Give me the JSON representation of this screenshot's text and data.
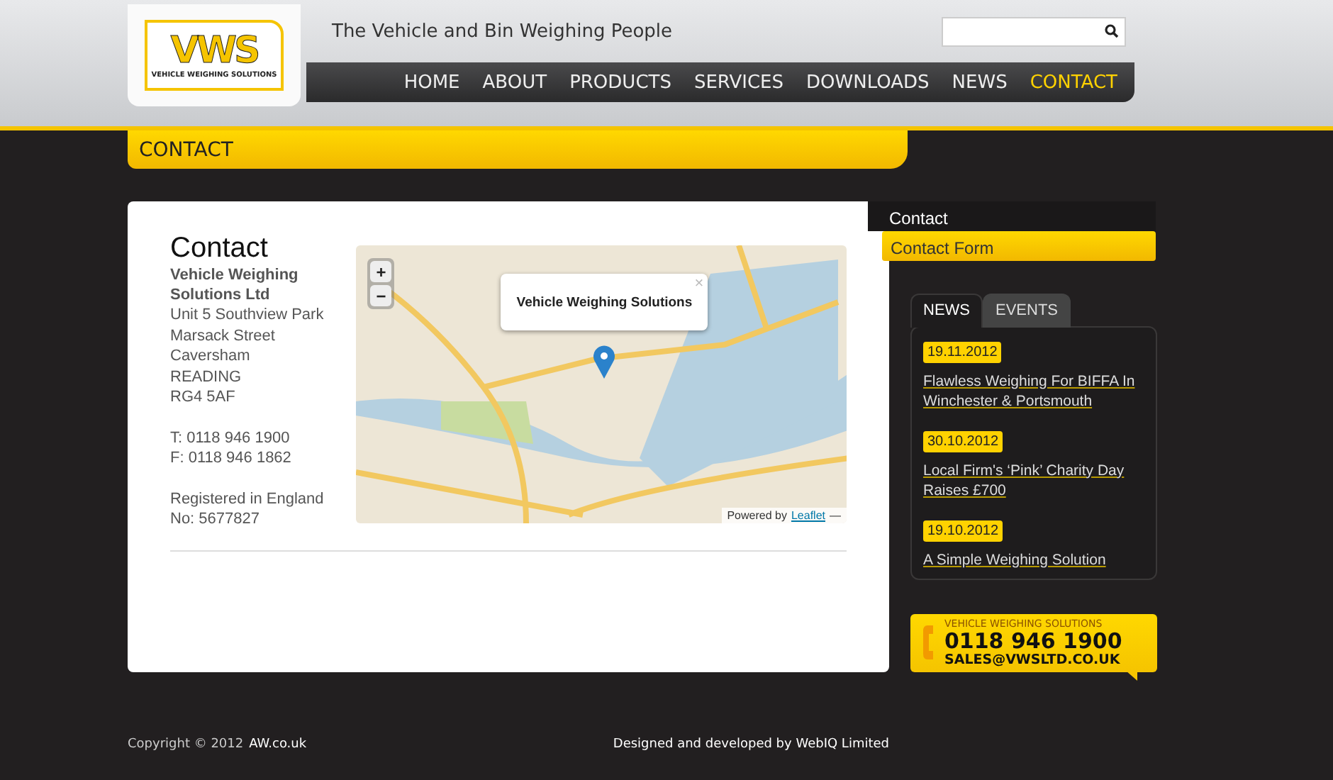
{
  "header": {
    "logo": {
      "mark": "VWS",
      "subtitle": "VEHICLE WEIGHING SOLUTIONS"
    },
    "tagline": "The Vehicle and Bin Weighing People",
    "nav": [
      {
        "label": "HOME",
        "selected": false
      },
      {
        "label": "ABOUT",
        "selected": false
      },
      {
        "label": "PRODUCTS",
        "selected": false
      },
      {
        "label": "SERVICES",
        "selected": false
      },
      {
        "label": "DOWNLOADS",
        "selected": false
      },
      {
        "label": "NEWS",
        "selected": false
      },
      {
        "label": "CONTACT",
        "selected": true
      }
    ]
  },
  "page_banner": "CONTACT",
  "contact": {
    "heading": "Contact",
    "company": "Vehicle Weighing Solutions Ltd",
    "address_lines": [
      "Unit 5 Southview Park",
      "Marsack Street",
      "Caversham",
      "READING",
      "RG4 5AF"
    ],
    "phone": "T: 0118 946 1900",
    "fax": "F: 0118 946 1862",
    "registration": "Registered in England No: 5677827"
  },
  "map": {
    "zoom_in": "+",
    "zoom_out": "−",
    "popup": {
      "title": "Vehicle Weighing Solutions",
      "close": "×"
    },
    "attribution": {
      "prefix": "Powered by",
      "link": "Leaflet",
      "suffix": "—"
    }
  },
  "sidebar": {
    "menu_title": "Contact",
    "menu_items": [
      {
        "label": "Contact Form",
        "selected": true
      }
    ],
    "tabs": [
      {
        "label": "NEWS",
        "selected": true
      },
      {
        "label": "EVENTS",
        "selected": false
      }
    ],
    "news": [
      {
        "date": "19.11.2012",
        "title": "Flawless Weighing For BIFFA In Winchester & Portsmouth"
      },
      {
        "date": "30.10.2012",
        "title": "Local Firm's ‘Pink’ Charity Day Raises £700"
      },
      {
        "date": "19.10.2012",
        "title": "A Simple Weighing Solution"
      }
    ],
    "callout": {
      "tagline": "VEHICLE WEIGHING SOLUTIONS",
      "phone": "0118 946 1900",
      "email": "SALES@VWSLTD.CO.UK"
    }
  },
  "footer": {
    "copyright": "Copyright © 2012",
    "copyright_link": "AW.co.uk",
    "credit": "Designed and developed by WebIQ Limited"
  }
}
